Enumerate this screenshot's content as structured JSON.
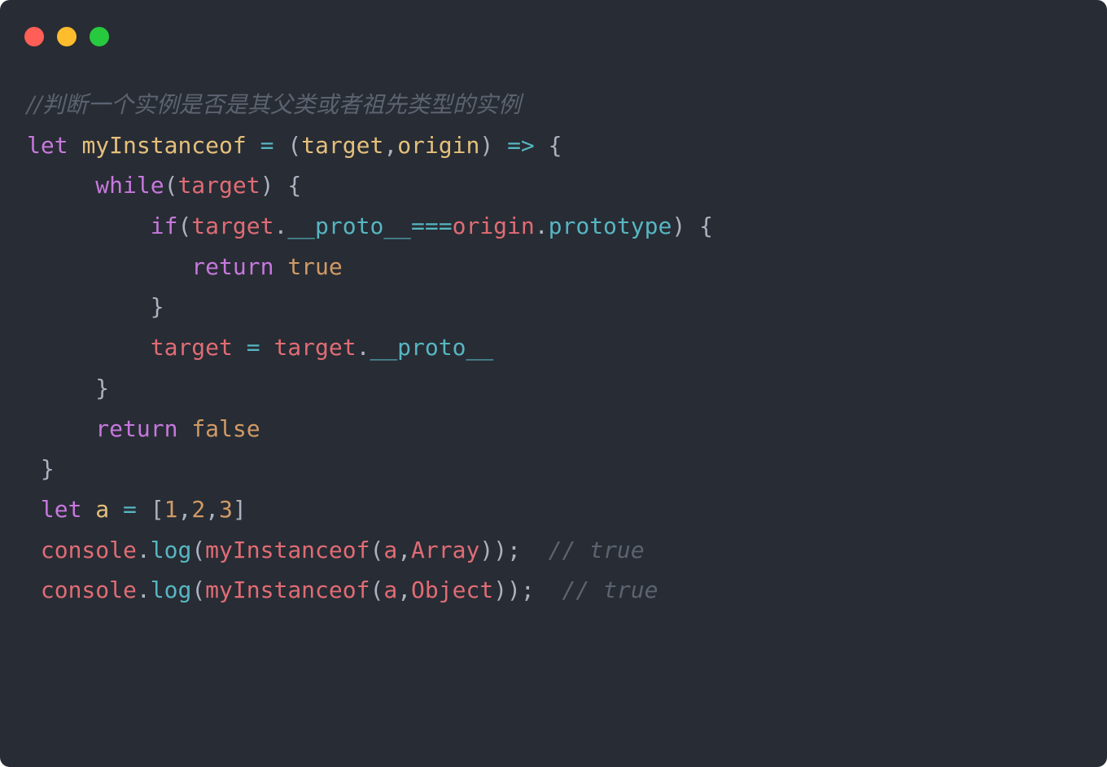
{
  "colors": {
    "background": "#282c34",
    "close": "#ff5f56",
    "minimize": "#ffbd2e",
    "maximize": "#27c93f",
    "keyword": "#c678dd",
    "variable": "#e06c75",
    "definition": "#e5c07b",
    "property": "#56b6c2",
    "number": "#d19a66",
    "punctuation": "#abb2bf",
    "comment": "#5c6370"
  },
  "code": {
    "lines": [
      {
        "indent": "",
        "tokens": [
          {
            "text": "//判断一个实例是否是其父类或者祖先类型的实例",
            "type": "comment",
            "serif": true
          }
        ]
      },
      {
        "indent": "",
        "tokens": [
          {
            "text": "let",
            "type": "keyword"
          },
          {
            "text": " ",
            "type": "plain"
          },
          {
            "text": "myInstanceof",
            "type": "definition"
          },
          {
            "text": " ",
            "type": "plain"
          },
          {
            "text": "=",
            "type": "property"
          },
          {
            "text": " ",
            "type": "plain"
          },
          {
            "text": "(",
            "type": "punctuation"
          },
          {
            "text": "target",
            "type": "definition"
          },
          {
            "text": ",",
            "type": "punctuation"
          },
          {
            "text": "origin",
            "type": "definition"
          },
          {
            "text": ")",
            "type": "punctuation"
          },
          {
            "text": " ",
            "type": "plain"
          },
          {
            "text": "=>",
            "type": "property"
          },
          {
            "text": " ",
            "type": "plain"
          },
          {
            "text": "{",
            "type": "punctuation"
          }
        ]
      },
      {
        "indent": "     ",
        "tokens": [
          {
            "text": "while",
            "type": "keyword"
          },
          {
            "text": "(",
            "type": "punctuation"
          },
          {
            "text": "target",
            "type": "variable"
          },
          {
            "text": ")",
            "type": "punctuation"
          },
          {
            "text": " ",
            "type": "plain"
          },
          {
            "text": "{",
            "type": "punctuation"
          }
        ]
      },
      {
        "indent": "         ",
        "tokens": [
          {
            "text": "if",
            "type": "keyword"
          },
          {
            "text": "(",
            "type": "punctuation"
          },
          {
            "text": "target",
            "type": "variable"
          },
          {
            "text": ".",
            "type": "punctuation"
          },
          {
            "text": "__proto__",
            "type": "property"
          },
          {
            "text": "===",
            "type": "property"
          },
          {
            "text": "origin",
            "type": "variable"
          },
          {
            "text": ".",
            "type": "punctuation"
          },
          {
            "text": "prototype",
            "type": "property"
          },
          {
            "text": ")",
            "type": "punctuation"
          },
          {
            "text": " ",
            "type": "plain"
          },
          {
            "text": "{",
            "type": "punctuation"
          }
        ]
      },
      {
        "indent": "            ",
        "tokens": [
          {
            "text": "return",
            "type": "keyword"
          },
          {
            "text": " ",
            "type": "plain"
          },
          {
            "text": "true",
            "type": "number"
          }
        ]
      },
      {
        "indent": "         ",
        "tokens": [
          {
            "text": "}",
            "type": "punctuation"
          }
        ]
      },
      {
        "indent": "         ",
        "tokens": [
          {
            "text": "target",
            "type": "variable"
          },
          {
            "text": " ",
            "type": "plain"
          },
          {
            "text": "=",
            "type": "property"
          },
          {
            "text": " ",
            "type": "plain"
          },
          {
            "text": "target",
            "type": "variable"
          },
          {
            "text": ".",
            "type": "punctuation"
          },
          {
            "text": "__proto__",
            "type": "property"
          }
        ]
      },
      {
        "indent": "     ",
        "tokens": [
          {
            "text": "}",
            "type": "punctuation"
          }
        ]
      },
      {
        "indent": "     ",
        "tokens": [
          {
            "text": "return",
            "type": "keyword"
          },
          {
            "text": " ",
            "type": "plain"
          },
          {
            "text": "false",
            "type": "number"
          }
        ]
      },
      {
        "indent": " ",
        "tokens": [
          {
            "text": "}",
            "type": "punctuation"
          }
        ]
      },
      {
        "indent": " ",
        "tokens": [
          {
            "text": "let",
            "type": "keyword"
          },
          {
            "text": " ",
            "type": "plain"
          },
          {
            "text": "a",
            "type": "definition"
          },
          {
            "text": " ",
            "type": "plain"
          },
          {
            "text": "=",
            "type": "property"
          },
          {
            "text": " ",
            "type": "plain"
          },
          {
            "text": "[",
            "type": "punctuation"
          },
          {
            "text": "1",
            "type": "number"
          },
          {
            "text": ",",
            "type": "punctuation"
          },
          {
            "text": "2",
            "type": "number"
          },
          {
            "text": ",",
            "type": "punctuation"
          },
          {
            "text": "3",
            "type": "number"
          },
          {
            "text": "]",
            "type": "punctuation"
          }
        ]
      },
      {
        "indent": " ",
        "tokens": [
          {
            "text": "console",
            "type": "variable"
          },
          {
            "text": ".",
            "type": "punctuation"
          },
          {
            "text": "log",
            "type": "property"
          },
          {
            "text": "(",
            "type": "punctuation"
          },
          {
            "text": "myInstanceof",
            "type": "variable"
          },
          {
            "text": "(",
            "type": "punctuation"
          },
          {
            "text": "a",
            "type": "variable"
          },
          {
            "text": ",",
            "type": "punctuation"
          },
          {
            "text": "Array",
            "type": "variable"
          },
          {
            "text": "));",
            "type": "punctuation"
          },
          {
            "text": "  ",
            "type": "plain"
          },
          {
            "text": "// true",
            "type": "comment"
          }
        ]
      },
      {
        "indent": " ",
        "tokens": [
          {
            "text": "console",
            "type": "variable"
          },
          {
            "text": ".",
            "type": "punctuation"
          },
          {
            "text": "log",
            "type": "property"
          },
          {
            "text": "(",
            "type": "punctuation"
          },
          {
            "text": "myInstanceof",
            "type": "variable"
          },
          {
            "text": "(",
            "type": "punctuation"
          },
          {
            "text": "a",
            "type": "variable"
          },
          {
            "text": ",",
            "type": "punctuation"
          },
          {
            "text": "Object",
            "type": "variable"
          },
          {
            "text": "));",
            "type": "punctuation"
          },
          {
            "text": "  ",
            "type": "plain"
          },
          {
            "text": "// true",
            "type": "comment"
          }
        ]
      }
    ]
  }
}
